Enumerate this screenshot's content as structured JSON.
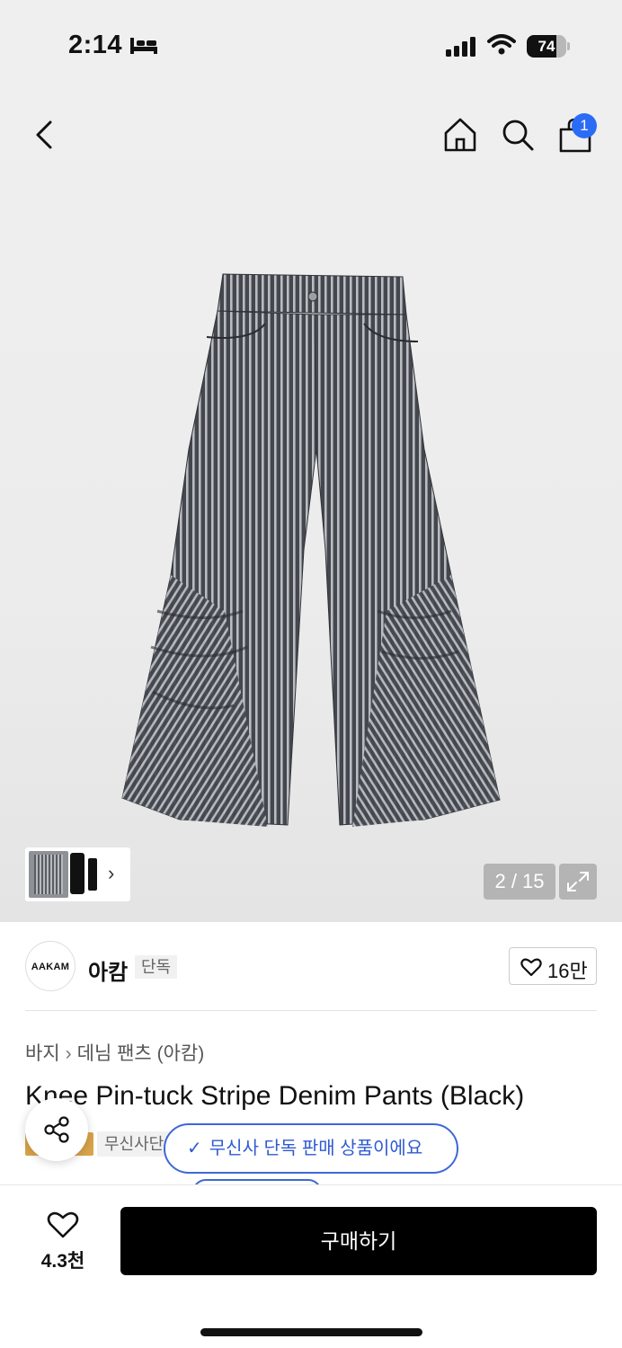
{
  "status_bar": {
    "time": "2:14",
    "battery": "74",
    "battery_level_percent": 74
  },
  "nav": {
    "icons": [
      "back-chevron-icon",
      "home-icon",
      "search-icon",
      "shopping-bag-icon"
    ],
    "cart_count": "1"
  },
  "gallery": {
    "counter": "2 / 15",
    "expand_icon": "expand-icon"
  },
  "brand": {
    "logo_text": "AAKAM",
    "name": "아캄",
    "tag": "단독",
    "likes": "16만"
  },
  "product": {
    "breadcrumb": [
      "바지",
      "데님 팬츠 (아캄)"
    ],
    "title": "Knee Pin-tuck Stripe Denim Pants (Black)",
    "badge_text": "무신사단독",
    "toast": "무신사 단독 판매 상품이에요"
  },
  "bottom": {
    "wish_count": "4.3천",
    "buy_label": "구매하기"
  },
  "colors": {
    "accent_blue": "#2b6cf6",
    "toast_blue": "#3e68d6",
    "badge_gold": "#d9a44a",
    "buy_black": "#000000"
  }
}
